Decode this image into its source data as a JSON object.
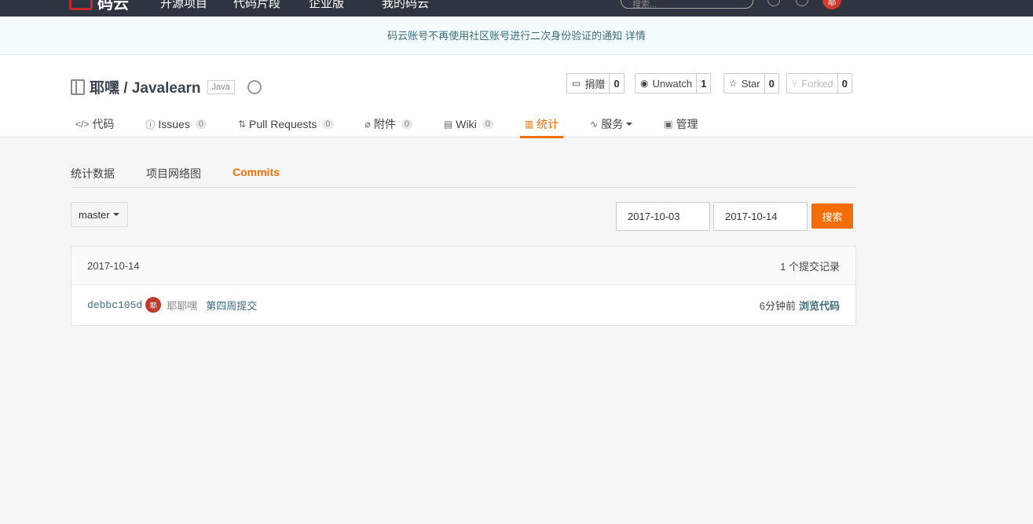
{
  "topnav": {
    "logo_text": "码云",
    "links": [
      "开源项目",
      "代码片段",
      "企业版",
      "我的码云"
    ],
    "search_placeholder": "搜索...",
    "avatar_text": "耶"
  },
  "notice": {
    "text": "码云账号不再使用社区账号进行二次身份验证的通知",
    "link": "详情"
  },
  "project": {
    "name": "耶嘿 / Javalearn",
    "language": "Java",
    "actions": [
      {
        "label": "捐赠",
        "count": "0",
        "icon": "donate-icon"
      },
      {
        "label": "Unwatch",
        "count": "1",
        "icon": "eye-icon"
      },
      {
        "label": "Star",
        "count": "0",
        "icon": "star-icon"
      },
      {
        "label": "Forked",
        "count": "0",
        "icon": "fork-icon"
      }
    ],
    "tabs": [
      {
        "label": "代码",
        "icon": "code-icon"
      },
      {
        "label": "Issues",
        "count": "0",
        "icon": "issue-icon"
      },
      {
        "label": "Pull Requests",
        "count": "0",
        "icon": "pull-request-icon"
      },
      {
        "label": "附件",
        "count": "0",
        "icon": "attachment-icon"
      },
      {
        "label": "Wiki",
        "count": "0",
        "icon": "wiki-icon"
      },
      {
        "label": "统计",
        "icon": "chart-icon"
      },
      {
        "label": "服务",
        "icon": "pulse-icon"
      },
      {
        "label": "管理",
        "icon": "settings-doc-icon"
      }
    ]
  },
  "subtabs": [
    "统计数据",
    "项目网络图",
    "Commits"
  ],
  "filters": {
    "branch": "master",
    "start_date": "2017-10-03",
    "end_date": "2017-10-14",
    "search_label": "搜索"
  },
  "commits": {
    "date": "2017-10-14",
    "summary": "1 个提交记录",
    "items": [
      {
        "sha": "debbc105d",
        "avatar": "耶",
        "author": "耶耶嘿",
        "message": "第四周提交",
        "time": "6分钟前",
        "browse": "浏览代码"
      }
    ]
  },
  "colors": {
    "accent": "#f36e08",
    "nav_bg": "#2e3440",
    "link": "#3e6b77"
  }
}
